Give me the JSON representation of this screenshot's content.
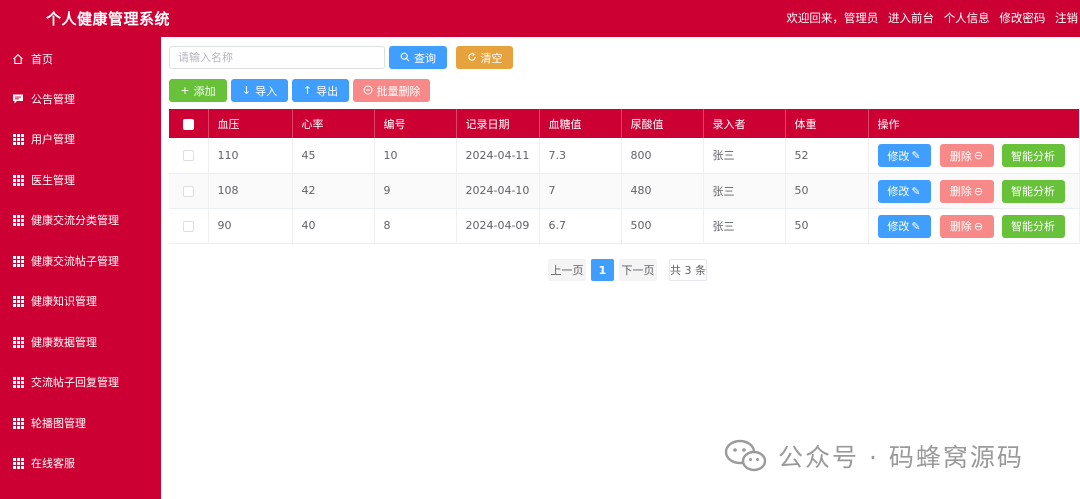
{
  "header": {
    "title": "个人健康管理系统",
    "welcome": "欢迎回来，管理员",
    "links": [
      "进入前台",
      "个人信息",
      "修改密码",
      "注销"
    ]
  },
  "sidebar": {
    "items": [
      {
        "label": "首页",
        "icon": "home-icon"
      },
      {
        "label": "公告管理",
        "icon": "chat-icon"
      },
      {
        "label": "用户管理",
        "icon": "grid-icon"
      },
      {
        "label": "医生管理",
        "icon": "grid-icon"
      },
      {
        "label": "健康交流分类管理",
        "icon": "grid-icon"
      },
      {
        "label": "健康交流帖子管理",
        "icon": "grid-icon"
      },
      {
        "label": "健康知识管理",
        "icon": "grid-icon"
      },
      {
        "label": "健康数据管理",
        "icon": "grid-icon"
      },
      {
        "label": "交流帖子回复管理",
        "icon": "grid-icon"
      },
      {
        "label": "轮播图管理",
        "icon": "grid-icon"
      },
      {
        "label": "在线客服",
        "icon": "grid-icon"
      }
    ]
  },
  "search": {
    "placeholder": "请输入名称",
    "value": "",
    "query_label": "查询",
    "clear_label": "清空"
  },
  "toolbar": {
    "add_label": "添加",
    "import_label": "导入",
    "export_label": "导出",
    "batch_delete_label": "批量删除"
  },
  "table": {
    "headers": [
      "血压",
      "心率",
      "编号",
      "记录日期",
      "血糖值",
      "尿酸值",
      "录入者",
      "体重",
      "操作"
    ],
    "rows": [
      {
        "blood_pressure": "110",
        "heart_rate": "45",
        "id": "10",
        "date": "2024-04-11",
        "blood_sugar": "7.3",
        "uric_acid": "800",
        "recorder": "张三",
        "weight": "52"
      },
      {
        "blood_pressure": "108",
        "heart_rate": "42",
        "id": "9",
        "date": "2024-04-10",
        "blood_sugar": "7",
        "uric_acid": "480",
        "recorder": "张三",
        "weight": "50"
      },
      {
        "blood_pressure": "90",
        "heart_rate": "40",
        "id": "8",
        "date": "2024-04-09",
        "blood_sugar": "6.7",
        "uric_acid": "500",
        "recorder": "张三",
        "weight": "50"
      }
    ],
    "actions": {
      "edit_label": "修改",
      "delete_label": "删除",
      "analyze_label": "智能分析"
    }
  },
  "pagination": {
    "prev_label": "上一页",
    "current_page": "1",
    "next_label": "下一页",
    "total_label": "共 3 条"
  },
  "watermark": {
    "text": "公众号 · 码蜂窝源码"
  },
  "colors": {
    "brand": "#cc0033",
    "primary": "#409eff",
    "warning": "#e6a23c",
    "success": "#67c23a",
    "danger": "#f56c6c"
  }
}
